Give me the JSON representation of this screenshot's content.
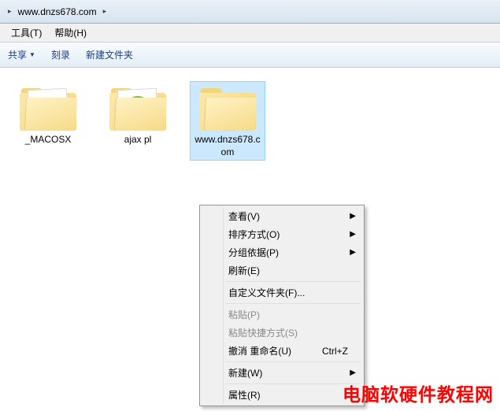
{
  "breadcrumb": {
    "segments": [
      "",
      "www.dnzs678.com"
    ]
  },
  "menubar": {
    "tools": "工具(T)",
    "help": "帮助(H)"
  },
  "toolbar": {
    "share": "共享",
    "burn": "刻录",
    "new_folder": "新建文件夹"
  },
  "items": [
    {
      "name": "_MACOSX",
      "type": "folder-doc"
    },
    {
      "name": "ajax pl",
      "type": "folder-ie"
    },
    {
      "name": "www.dnzs678.com",
      "type": "folder"
    }
  ],
  "context_menu": {
    "view": "查看(V)",
    "sort": "排序方式(O)",
    "group": "分组依据(P)",
    "refresh": "刷新(E)",
    "customize": "自定义文件夹(F)...",
    "paste": "粘贴(P)",
    "paste_shortcut": "粘贴快捷方式(S)",
    "undo": "撤消 重命名(U)",
    "undo_key": "Ctrl+Z",
    "new": "新建(W)",
    "properties": "属性(R)"
  },
  "watermark": "电脑软硬件教程网"
}
